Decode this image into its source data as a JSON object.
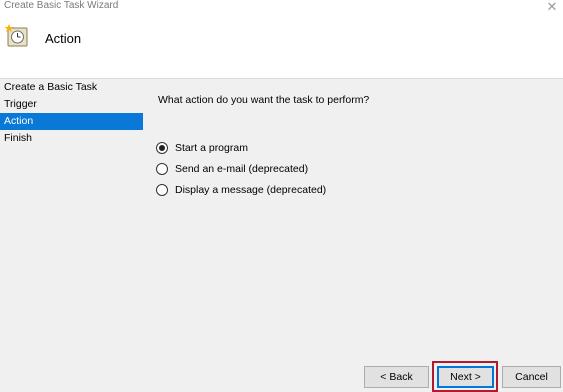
{
  "window": {
    "title": "Create Basic Task Wizard",
    "close_glyph": "✕"
  },
  "header": {
    "title": "Action",
    "icon": "task-scheduler-icon"
  },
  "nav": {
    "items": [
      {
        "label": "Create a Basic Task",
        "active": false
      },
      {
        "label": "Trigger",
        "active": false
      },
      {
        "label": "Action",
        "active": true
      },
      {
        "label": "Finish",
        "active": false
      }
    ]
  },
  "content": {
    "question": "What action do you want the task to perform?",
    "options": [
      {
        "label": "Start a program",
        "checked": true
      },
      {
        "label": "Send an e-mail (deprecated)",
        "checked": false
      },
      {
        "label": "Display a message (deprecated)",
        "checked": false
      }
    ]
  },
  "buttons": {
    "back": "< Back",
    "next": "Next >",
    "cancel": "Cancel"
  },
  "colors": {
    "accent": "#0a78d7",
    "highlight_box": "#b01c2e"
  }
}
